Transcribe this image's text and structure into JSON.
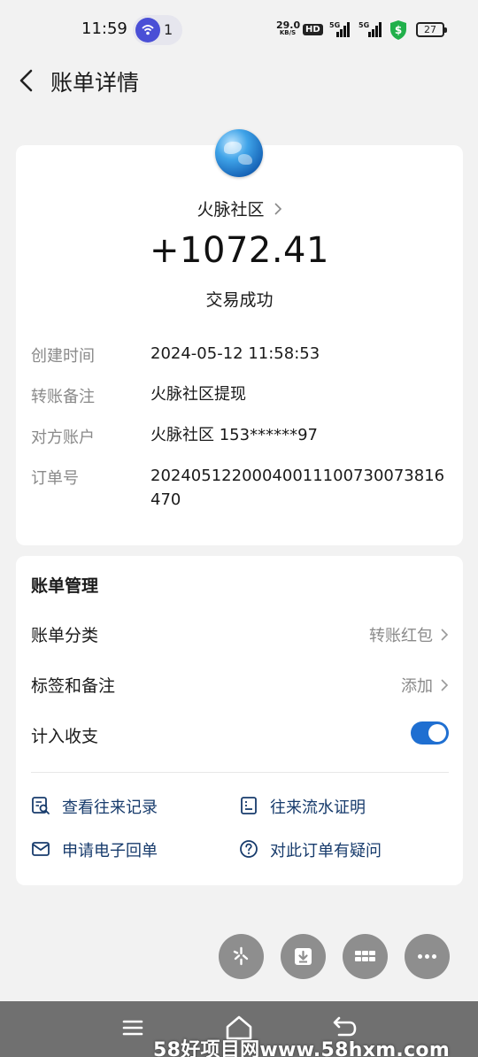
{
  "status_bar": {
    "time": "11:59",
    "notification_count": "1",
    "net_speed_value": "29.0",
    "net_speed_unit": "KB/S",
    "hd_label": "HD",
    "sim1_tag": "5G",
    "sim2_tag": "5G",
    "battery": "27"
  },
  "header": {
    "title": "账单详情",
    "back_icon": "chevron-left-icon"
  },
  "detail": {
    "merchant_name": "火脉社区",
    "amount": "+1072.41",
    "status": "交易成功",
    "rows": [
      {
        "label": "创建时间",
        "value": "2024-05-12 11:58:53"
      },
      {
        "label": "转账备注",
        "value": "火脉社区提现"
      },
      {
        "label": "对方账户",
        "value": "火脉社区 153******97"
      },
      {
        "label": "订单号",
        "value": "20240512200040011100730073816470"
      }
    ]
  },
  "manage": {
    "title": "账单管理",
    "category_label": "账单分类",
    "category_value": "转账红包",
    "tags_label": "标签和备注",
    "tags_value": "添加",
    "income_label": "计入收支",
    "income_enabled": true,
    "links": [
      {
        "label": "查看往来记录",
        "icon": "search-record-icon"
      },
      {
        "label": "往来流水证明",
        "icon": "document-icon"
      },
      {
        "label": "申请电子回单",
        "icon": "mail-icon"
      },
      {
        "label": "对此订单有疑问",
        "icon": "question-icon"
      }
    ]
  },
  "actions": [
    "sparkle-icon",
    "download-icon",
    "grid-icon",
    "more-icon"
  ],
  "navbar": {
    "watermark": "58好项目网www.58hxm.com"
  },
  "colors": {
    "background": "#f2f2f2",
    "card": "#ffffff",
    "link": "#173b6c",
    "toggle_on": "#1f6fd1",
    "secondary_text": "#8a8a8a"
  }
}
